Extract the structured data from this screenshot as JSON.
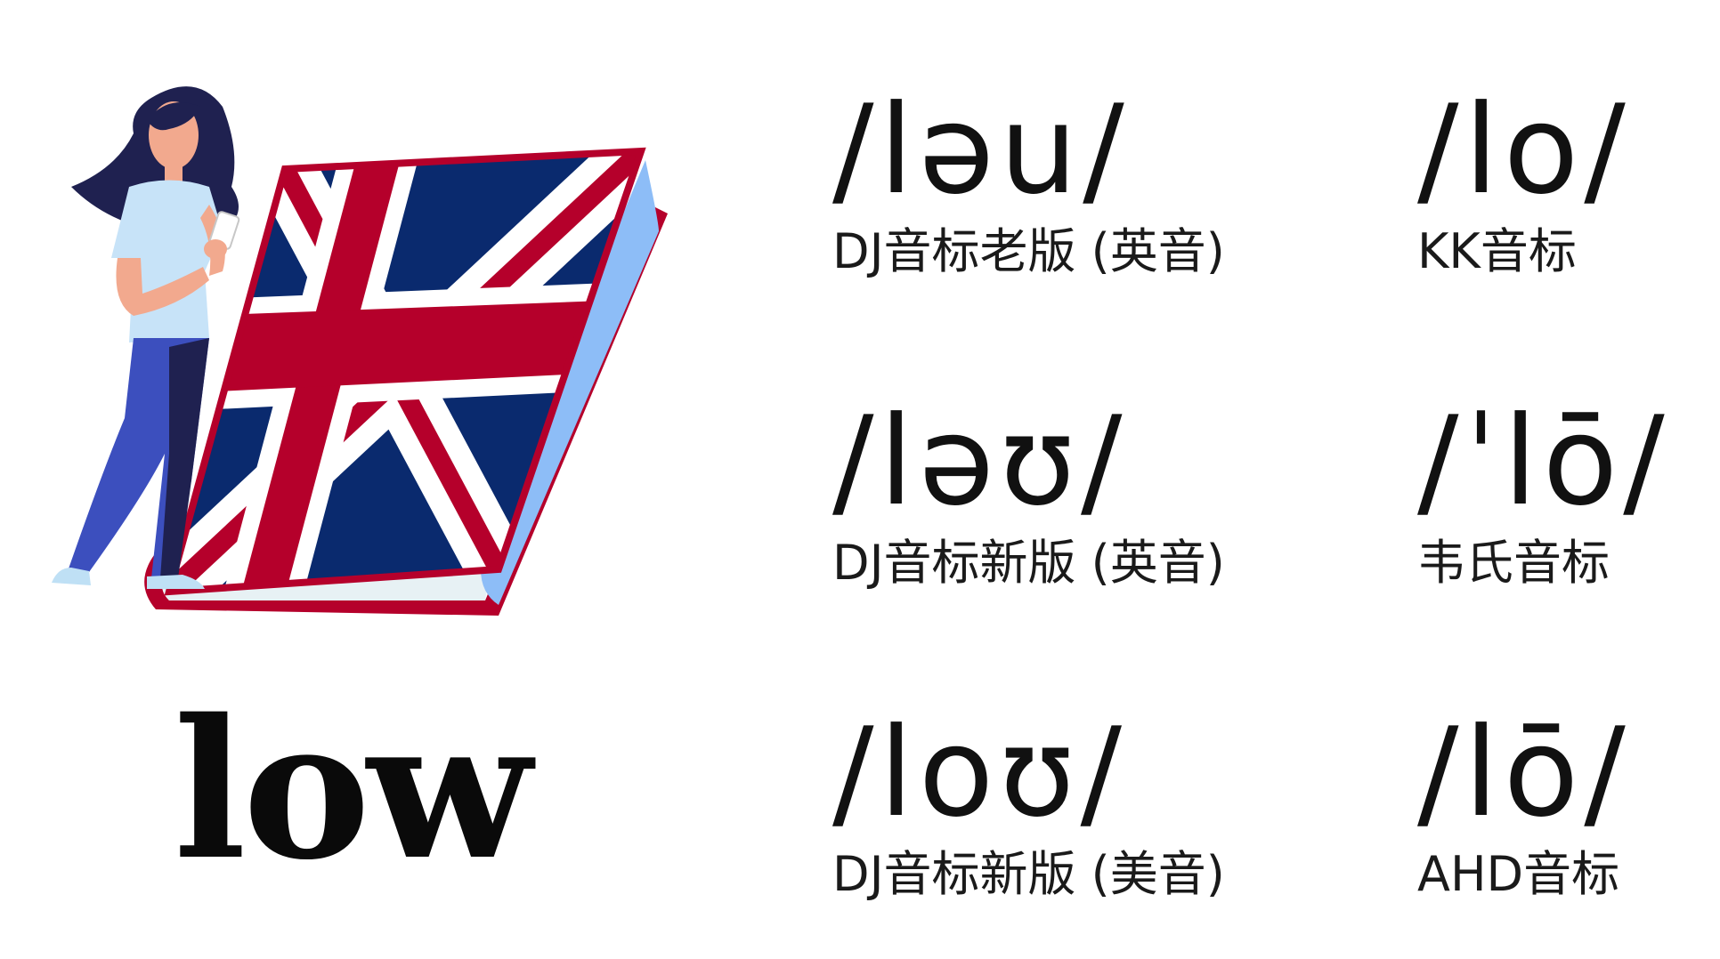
{
  "word": "low",
  "illustration": {
    "icon": "woman-with-phone-leaning-on-union-jack-book-icon",
    "colors": {
      "flag_blue": "#0a2a6e",
      "flag_red": "#b5002b",
      "book_edge": "#8dbdf7",
      "pages": "#e7f1f4",
      "hair": "#1f2150",
      "skin": "#f2a98e",
      "shirt": "#c7e3f8",
      "jeans": "#3c4fbe"
    }
  },
  "phonetics": [
    {
      "ipa": "/ləu/",
      "label": "DJ音标老版 (英音)"
    },
    {
      "ipa": "/lo/",
      "label": "KK音标"
    },
    {
      "ipa": "/ləʊ/",
      "label": "DJ音标新版 (英音)"
    },
    {
      "ipa": "/ˈlō/",
      "label": "韦氏音标"
    },
    {
      "ipa": "/loʊ/",
      "label": "DJ音标新版 (美音)"
    },
    {
      "ipa": "/lō/",
      "label": "AHD音标"
    }
  ]
}
